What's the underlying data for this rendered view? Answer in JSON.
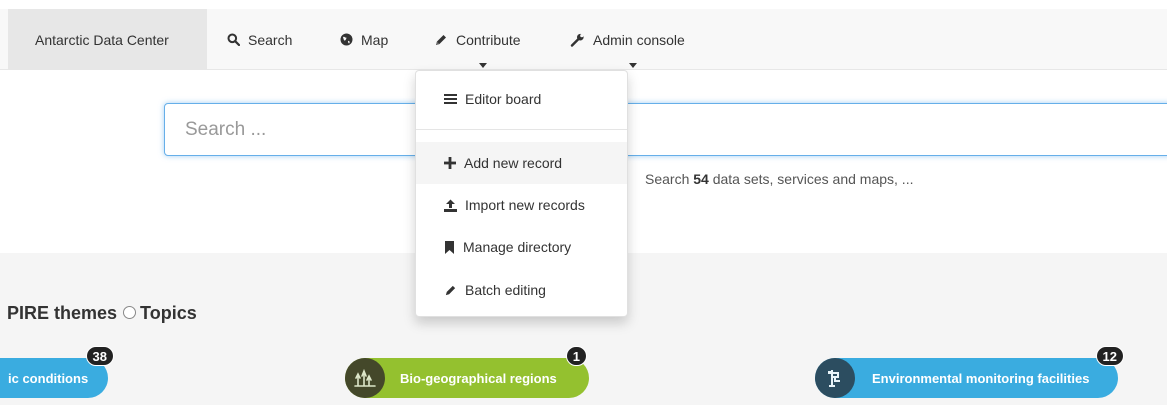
{
  "navbar": {
    "brand": "Antarctic Data Center",
    "items": [
      {
        "label": "Search",
        "icon": "search-icon"
      },
      {
        "label": "Map",
        "icon": "globe-icon"
      },
      {
        "label": "Contribute",
        "icon": "pencil-icon"
      },
      {
        "label": "Admin console",
        "icon": "wrench-icon"
      }
    ]
  },
  "contribute_menu": {
    "items": [
      {
        "label": "Editor board",
        "icon": "list-icon"
      },
      {
        "label": "Add new record",
        "icon": "plus-icon"
      },
      {
        "label": "Import new records",
        "icon": "upload-icon"
      },
      {
        "label": "Manage directory",
        "icon": "bookmark-icon"
      },
      {
        "label": "Batch editing",
        "icon": "pencil-icon"
      }
    ]
  },
  "search": {
    "placeholder": "Search ...",
    "stats_prefix": "Search",
    "stats_count": "54",
    "stats_suffix": "data sets, services and maps, ..."
  },
  "themes": {
    "label_inspire": "PIRE themes",
    "label_topics": "Topics"
  },
  "categories": [
    {
      "label": "ic conditions",
      "count": "38",
      "color": "#3aace0"
    },
    {
      "label": "Bio-geographical regions",
      "count": "1",
      "color": "#94c12f",
      "icon_color": "#44482a"
    },
    {
      "label": "Environmental monitoring facilities",
      "count": "12",
      "color": "#3aace0",
      "icon_color": "#2c4d60"
    }
  ]
}
